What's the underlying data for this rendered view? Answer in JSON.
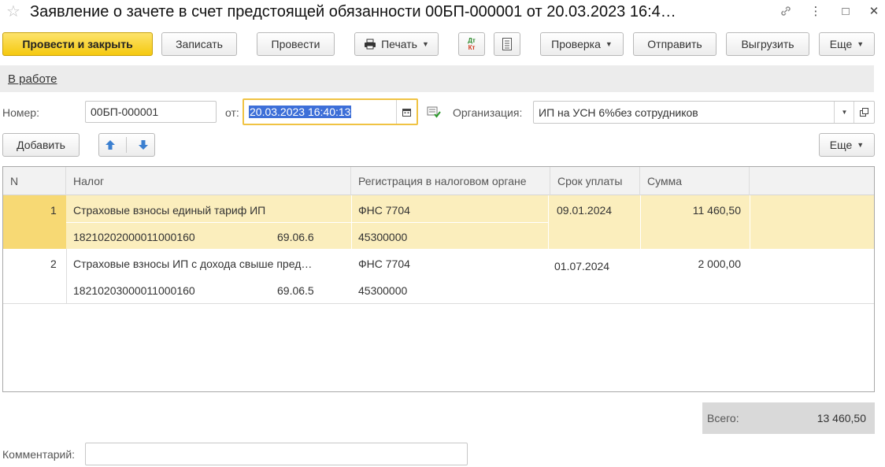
{
  "window": {
    "title": "Заявление о зачете в счет предстоящей обязанности 00БП-000001 от 20.03.2023 16:4…",
    "star_icon": "☆",
    "link_icon": "🔗",
    "menu_icon": "⋮",
    "maximize_icon": "□",
    "close_icon": "✕"
  },
  "toolbar": {
    "post_close": "Провести и закрыть",
    "save": "Записать",
    "post": "Провести",
    "print": "Печать",
    "dtkt_top": "Дт",
    "dtkt_bottom": "Кт",
    "check": "Проверка",
    "send": "Отправить",
    "export": "Выгрузить",
    "more": "Еще"
  },
  "status": {
    "link": "В работе"
  },
  "form": {
    "number_label": "Номер:",
    "number_value": "00БП-000001",
    "date_label": "от:",
    "date_value": "20.03.2023 16:40:13",
    "org_label": "Организация:",
    "org_value": "ИП на УСН 6%без сотрудников"
  },
  "table_toolbar": {
    "add": "Добавить",
    "more": "Еще"
  },
  "table": {
    "headers": [
      "N",
      "Налог",
      "Регистрация в налоговом органе",
      "Срок уплаты",
      "Сумма"
    ],
    "rows": [
      {
        "n": "1",
        "tax": "Страховые взносы единый тариф ИП",
        "kbk": "18210202000011000160",
        "account": "69.06.6",
        "reg": "ФНС 7704",
        "oktmo": "45300000",
        "due": "09.01.2024",
        "amount": "11 460,50"
      },
      {
        "n": "2",
        "tax": "Страховые взносы ИП с дохода свыше пред…",
        "kbk": "18210203000011000160",
        "account": "69.06.5",
        "reg": "ФНС 7704",
        "oktmo": "45300000",
        "due": "01.07.2024",
        "amount": "2 000,00"
      }
    ]
  },
  "totals": {
    "label": "Всего:",
    "value": "13 460,50"
  },
  "comment": {
    "label": "Комментарий:",
    "value": ""
  },
  "colors": {
    "primary": "#f5c90f",
    "selected_row": "#fbeebd",
    "focus": "#f0c343"
  }
}
